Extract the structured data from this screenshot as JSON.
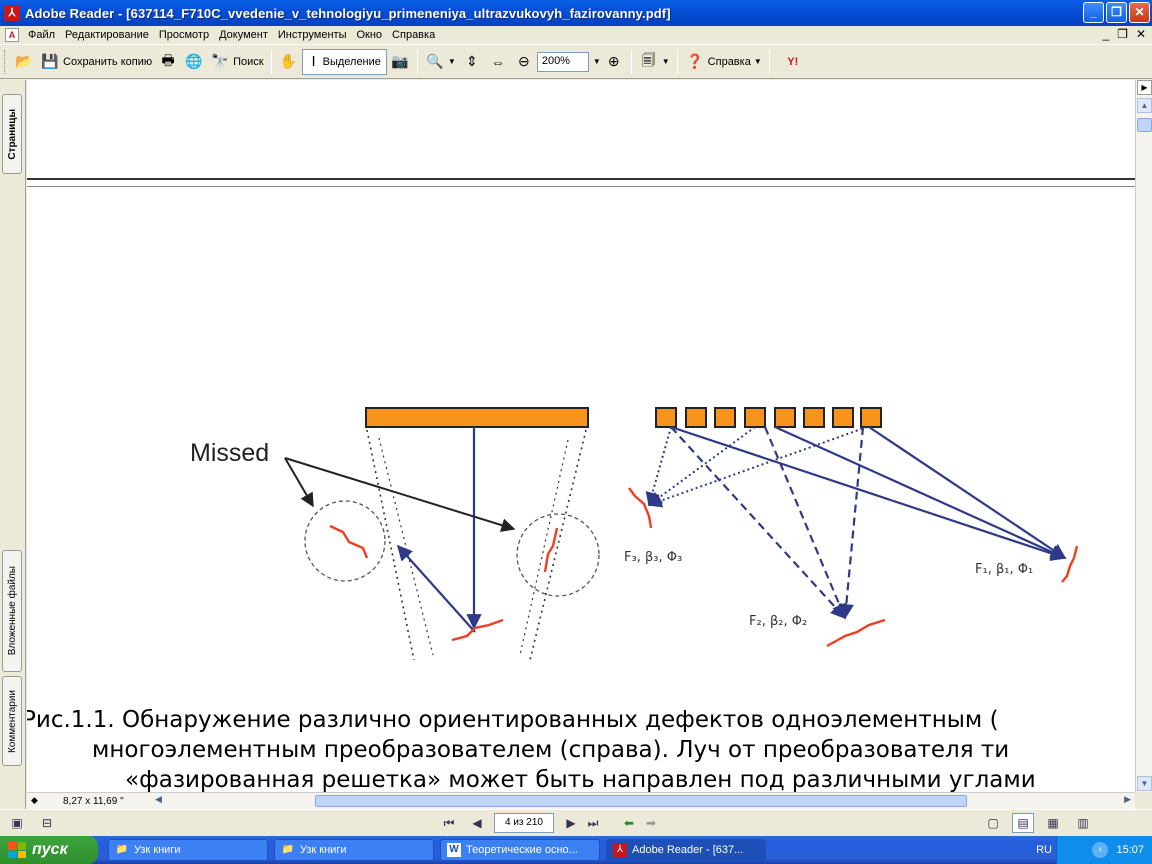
{
  "window": {
    "title": "Adobe Reader - [637114_F710C_vvedenie_v_tehnologiyu_primeneniya_ultrazvukovyh_fazirovanny.pdf]",
    "app_icon": "adobe-reader-icon"
  },
  "menu": {
    "items": [
      "Файл",
      "Редактирование",
      "Просмотр",
      "Документ",
      "Инструменты",
      "Окно",
      "Справка"
    ]
  },
  "toolbar": {
    "save_copy": "Сохранить копию",
    "search": "Поиск",
    "select": "Выделение",
    "zoom": "200%",
    "help": "Справка"
  },
  "side_tabs": {
    "pages": "Страницы",
    "attachments": "Вложенные файлы",
    "comments": "Комментарии"
  },
  "figure": {
    "missed_label": "Missed",
    "label_f3": "F₃, β₃, Φ₃",
    "label_f2": "F₂, β₂, Φ₂",
    "label_f1": "F₁, β₁, Φ₁",
    "colors": {
      "transducer": "#F7941D",
      "defect": "#EF3E23",
      "beam": "#2E3A87"
    }
  },
  "caption": {
    "line1": "Рис.1.1. Обнаружение различно ориентированных дефектов одноэлементным (",
    "line2": "многоэлементным преобразователем (справа).  Луч от преобразователя ти",
    "line3": "«фазированная решетка» может быть направлен под различными углами"
  },
  "status": {
    "page_size": "8,27 x 11,69 \"",
    "page_field": "4 из 210"
  },
  "taskbar": {
    "start": "пуск",
    "tasks": [
      "Узк книги",
      "Узк книги",
      "Теоретические осно...",
      "Adobe Reader - [637..."
    ],
    "lang": "RU",
    "clock": "15:07"
  }
}
